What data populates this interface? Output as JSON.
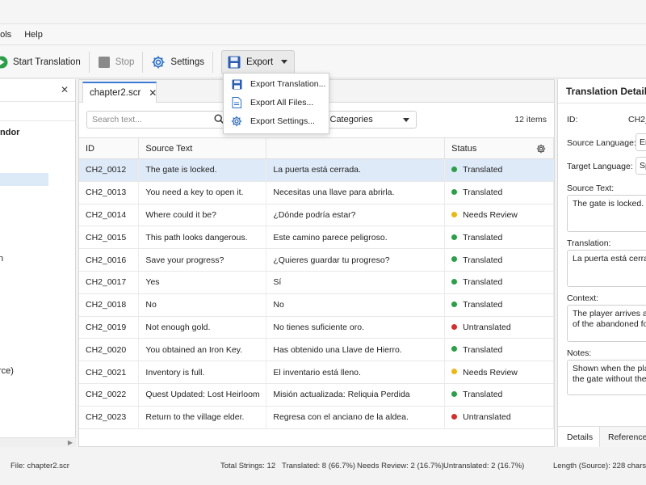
{
  "menu": [
    "ools",
    "Help"
  ],
  "toolbar": {
    "start_label": "Start Translation",
    "stop_label": "Stop",
    "settings_label": "Settings",
    "export_label": "Export"
  },
  "export_menu": [
    "Export Translation...",
    "Export All Files...",
    "Export Settings..."
  ],
  "left_panel": {
    "tree": [
      "ndor",
      "n",
      "rce)"
    ]
  },
  "tab": {
    "label": "chapter2.scr"
  },
  "filter": {
    "search_placeholder": "Search text...",
    "category_value": "l Categories",
    "count": "12 items"
  },
  "table": {
    "headers": [
      "ID",
      "Source Text",
      "",
      "Status"
    ],
    "rows": [
      {
        "id": "CH2_0012",
        "source": "The gate is locked.",
        "translation": "La puerta está cerrada.",
        "status": "Translated"
      },
      {
        "id": "CH2_0013",
        "source": "You need a key to open it.",
        "translation": "Necesitas una llave para abrirla.",
        "status": "Translated"
      },
      {
        "id": "CH2_0014",
        "source": "Where could it be?",
        "translation": "¿Dónde podría estar?",
        "status": "Needs Review"
      },
      {
        "id": "CH2_0015",
        "source": "This path looks dangerous.",
        "translation": "Este camino parece peligroso.",
        "status": "Translated"
      },
      {
        "id": "CH2_0016",
        "source": "Save your progress?",
        "translation": "¿Quieres guardar tu progreso?",
        "status": "Translated"
      },
      {
        "id": "CH2_0017",
        "source": "Yes",
        "translation": "Sí",
        "status": "Translated"
      },
      {
        "id": "CH2_0018",
        "source": "No",
        "translation": "No",
        "status": "Translated"
      },
      {
        "id": "CH2_0019",
        "source": "Not enough gold.",
        "translation": "No tienes suficiente oro.",
        "status": "Untranslated"
      },
      {
        "id": "CH2_0020",
        "source": "You obtained an Iron Key.",
        "translation": "Has obtenido una Llave de Hierro.",
        "status": "Translated"
      },
      {
        "id": "CH2_0021",
        "source": "Inventory is full.",
        "translation": "El inventario está lleno.",
        "status": "Needs Review"
      },
      {
        "id": "CH2_0022",
        "source": "Quest Updated: Lost Heirloom",
        "translation": "Misión actualizada: Reliquia Perdida",
        "status": "Translated"
      },
      {
        "id": "CH2_0023",
        "source": "Return to the village elder.",
        "translation": "Regresa con el anciano de la aldea.",
        "status": "Untranslated"
      }
    ]
  },
  "status_colors": {
    "Translated": "#2e9e4a",
    "Needs Review": "#e8b71a",
    "Untranslated": "#d0312d"
  },
  "details": {
    "title": "Translation Details",
    "id_label": "ID:",
    "id_value": "CH2_",
    "source_lang_label": "Source Language:",
    "source_lang_value": "Er",
    "target_lang_label": "Target Language:",
    "target_lang_value": "Sp",
    "source_text_label": "Source Text:",
    "source_text_value": "The gate is locked.",
    "translation_label": "Translation:",
    "translation_value": "La puerta está cerrad",
    "context_label": "Context:",
    "context_line1": "The player arrives at t",
    "context_line2": "of the abandoned for",
    "notes_label": "Notes:",
    "notes_line1": "Shown when the play",
    "notes_line2": "the gate without the k",
    "tab_details": "Details",
    "tab_references": "References"
  },
  "statusbar": {
    "file": "File: chapter2.scr",
    "total": "Total Strings: 12",
    "translated": "Translated: 8 (66.7%)",
    "review": "Needs Review: 2 (16.7%)",
    "untranslated": "Untranslated: 2 (16.7%)",
    "length": "Length (Source): 228 chars"
  }
}
